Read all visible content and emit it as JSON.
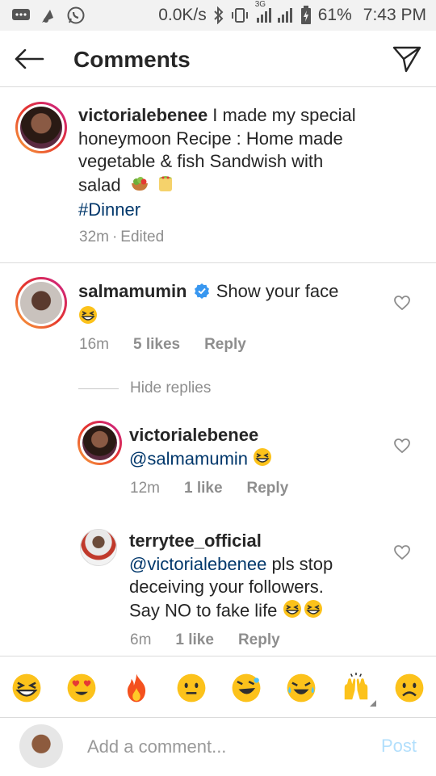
{
  "status_bar": {
    "speed": "0.0K/s",
    "network": "3G",
    "battery": "61%",
    "time": "7:43 PM"
  },
  "header": {
    "title": "Comments"
  },
  "caption": {
    "username": "victorialebenee",
    "text_line1": " I made my special",
    "text_line2": "honeymoon Recipe : Home made",
    "text_line3": "vegetable & fish Sandwish with",
    "text_line4": "salad",
    "hashtag": "#Dinner",
    "time": "32m",
    "separator": "·",
    "edited": "Edited"
  },
  "comments": [
    {
      "username": "salmamumin",
      "verified": true,
      "text": "Show your face",
      "time": "16m",
      "likes": "5 likes",
      "reply": "Reply"
    }
  ],
  "hide_replies": "Hide replies",
  "replies": [
    {
      "username": "victorialebenee",
      "mention": "@salmamumin",
      "text": "",
      "time": "12m",
      "likes": "1 like",
      "reply": "Reply"
    },
    {
      "username": "terrytee_official",
      "mention": "@victorialebenee",
      "text_line1": " pls stop",
      "text_line2": "deceiving your followers.",
      "text_line3": "Say NO to fake life",
      "time": "6m",
      "likes": "1 like",
      "reply": "Reply"
    }
  ],
  "emoji_bar": [
    "grin-squint-emoji",
    "heart-eyes-emoji",
    "fire-emoji",
    "neutral-face-emoji",
    "laughing-wink-emoji",
    "crying-laughing-emoji",
    "raised-hands-emoji",
    "frowning-face-emoji"
  ],
  "composer": {
    "placeholder": "Add a comment...",
    "post_label": "Post"
  },
  "colors": {
    "link": "#00376b",
    "meta": "#8e8e8e",
    "post_disabled": "#b2dffc",
    "verified": "#3897f0"
  }
}
